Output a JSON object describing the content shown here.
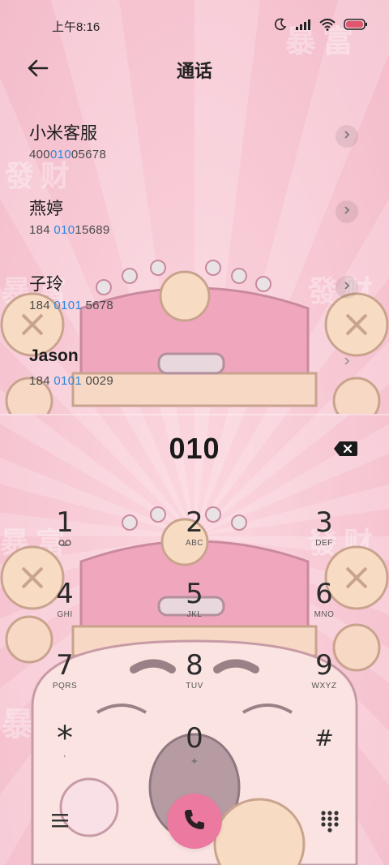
{
  "status": {
    "time": "上午8:16",
    "icons": [
      "moon-icon",
      "signal-icon",
      "wifi-icon",
      "battery-icon"
    ]
  },
  "header": {
    "title": "通话",
    "back_icon": "arrow-left-icon"
  },
  "contacts": [
    {
      "name": "小米客服",
      "number_pre": "400",
      "number_hl": "010",
      "number_post": "05678"
    },
    {
      "name": "燕婷",
      "number_pre": "184 ",
      "number_hl": "010",
      "number_post": "15689"
    },
    {
      "name": "子玲",
      "number_pre": "184 ",
      "number_hl": "0101",
      "number_post": " 5678"
    },
    {
      "name": "Jason",
      "number_pre": "184 ",
      "number_hl": "0101",
      "number_post": " 0029"
    }
  ],
  "dialer": {
    "number": "010",
    "keys": [
      {
        "digit": "1",
        "sub": "ထ"
      },
      {
        "digit": "2",
        "sub": "ABC"
      },
      {
        "digit": "3",
        "sub": "DEF"
      },
      {
        "digit": "4",
        "sub": "GHI"
      },
      {
        "digit": "5",
        "sub": "JKL"
      },
      {
        "digit": "6",
        "sub": "MNO"
      },
      {
        "digit": "7",
        "sub": "PQRS"
      },
      {
        "digit": "8",
        "sub": "TUV"
      },
      {
        "digit": "9",
        "sub": "WXYZ"
      },
      {
        "digit": "*",
        "sub": ","
      },
      {
        "digit": "0",
        "sub": "+"
      },
      {
        "digit": "#",
        "sub": ""
      }
    ]
  },
  "wallpaper": {
    "text_a": "暴富",
    "text_b": "發财"
  },
  "colors": {
    "background": "#f9cdd8",
    "highlight": "#2a86e0",
    "call_button": "#ec7aa0"
  }
}
